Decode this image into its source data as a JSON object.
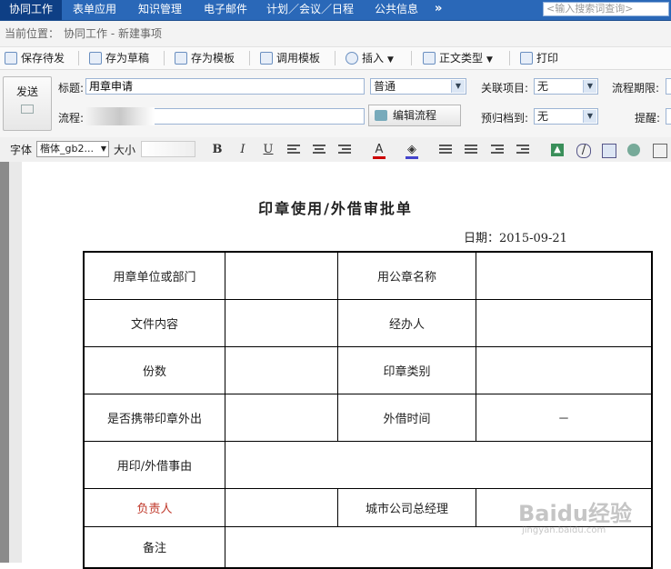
{
  "nav": {
    "items": [
      "协同工作",
      "表单应用",
      "知识管理",
      "电子邮件",
      "计划／会议／日程",
      "公共信息"
    ],
    "more": "»",
    "search_placeholder": "<输入搜索词查询>"
  },
  "breadcrumb": {
    "prefix": "当前位置：",
    "path": "协同工作 - 新建事项"
  },
  "toolbar": {
    "save_pending": "保存待发",
    "save_draft": "存为草稿",
    "save_template": "存为模板",
    "use_template": "调用模板",
    "insert": "插入",
    "body_type": "正文类型",
    "print": "打印"
  },
  "form": {
    "send_label": "发送",
    "title_label": "标题:",
    "title_value": "用章申请",
    "priority_value": "普通",
    "related_label": "关联项目:",
    "related_value": "无",
    "deadline_label": "流程期限:",
    "flow_label": "流程:",
    "edit_flow_label": "编辑流程",
    "archive_label": "预归档到:",
    "archive_value": "无",
    "remind_label": "提醒:"
  },
  "editor": {
    "font_label": "字体",
    "font_value": "楷体_gb2...",
    "size_label": "大小"
  },
  "document": {
    "title": "印章使用/外借审批单",
    "date": "日期：2015-09-21",
    "rows": [
      [
        "用章单位或部门",
        "",
        "用公章名称",
        ""
      ],
      [
        "文件内容",
        "",
        "经办人",
        ""
      ],
      [
        "份数",
        "",
        "印章类别",
        ""
      ],
      [
        "是否携带印章外出",
        "",
        "外借时间",
        "－"
      ],
      [
        "用印/外借事由",
        ""
      ],
      [
        "负责人",
        "",
        "城市公司总经理",
        ""
      ],
      [
        "备注",
        ""
      ]
    ]
  },
  "watermark": {
    "text": "Baidu经验",
    "sub": "jingyan.baidu.com"
  },
  "colors": {
    "nav_bg": "#2a68b8",
    "nav_active": "#0e3f85",
    "responsible_text": "#c0392b"
  }
}
